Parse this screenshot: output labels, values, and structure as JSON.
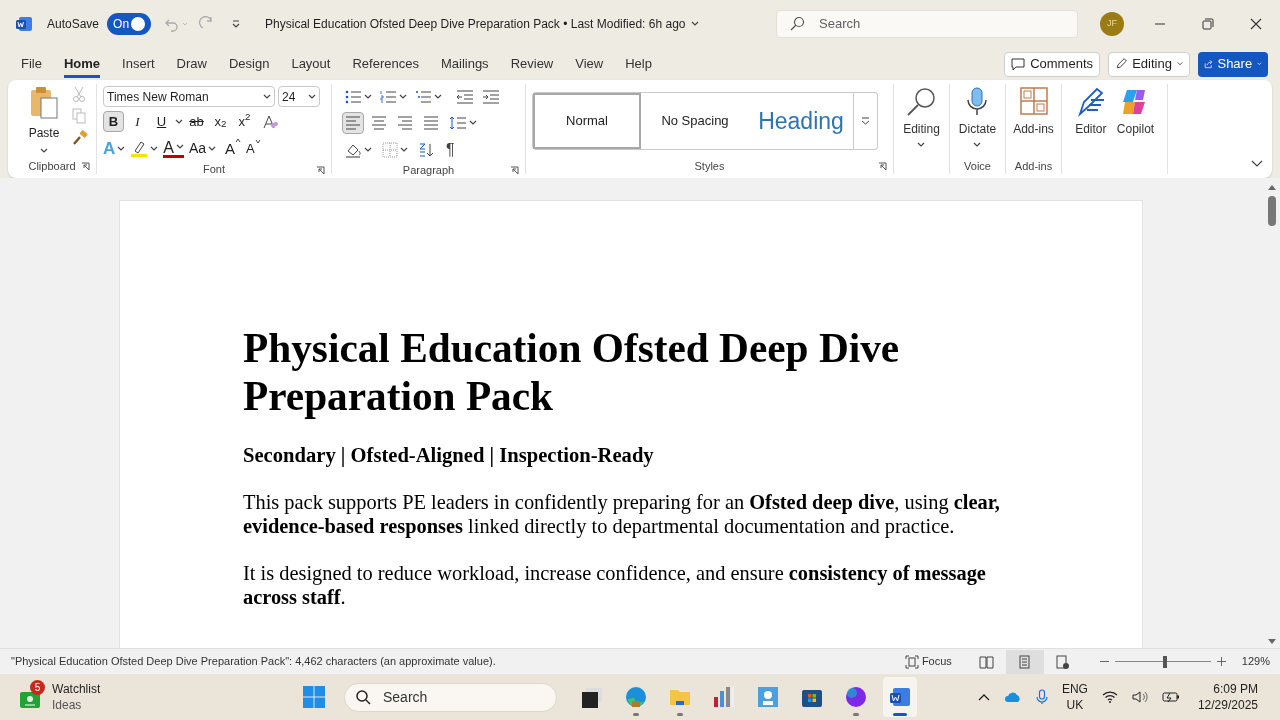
{
  "title_bar": {
    "autosave_label": "AutoSave",
    "autosave": {
      "on": true,
      "label": "On"
    },
    "document_title": "Physical Education Ofsted Deep Dive Preparation Pack • Last Modified: 6h ago",
    "search_placeholder": "Search",
    "avatar_initials": "JF"
  },
  "tabs": [
    {
      "label": "File",
      "selected": false
    },
    {
      "label": "Home",
      "selected": true
    },
    {
      "label": "Insert",
      "selected": false
    },
    {
      "label": "Draw",
      "selected": false
    },
    {
      "label": "Design",
      "selected": false
    },
    {
      "label": "Layout",
      "selected": false
    },
    {
      "label": "References",
      "selected": false
    },
    {
      "label": "Mailings",
      "selected": false
    },
    {
      "label": "Review",
      "selected": false
    },
    {
      "label": "View",
      "selected": false
    },
    {
      "label": "Help",
      "selected": false
    }
  ],
  "header_buttons": [
    {
      "kind": "comments",
      "label": "Comments"
    },
    {
      "kind": "editing",
      "label": "Editing"
    },
    {
      "kind": "share",
      "label": "Share"
    }
  ],
  "ribbon": {
    "clipboard": {
      "paste_label": "Paste",
      "group_label": "Clipboard"
    },
    "font": {
      "name": "Times New Roman",
      "size": "24",
      "group_label": "Font",
      "format_buttons": [
        {
          "label": "B",
          "selected": true
        },
        {
          "label": "I",
          "selected": false
        },
        {
          "label": "U",
          "selected": false
        },
        {
          "label": "ab",
          "selected": false
        },
        {
          "label": "x$_{2}$",
          "selected": false
        },
        {
          "label": "x$^{2}$",
          "selected": false
        }
      ],
      "tools": [
        {
          "kind": "effects",
          "label": "A"
        },
        {
          "kind": "highlight"
        },
        {
          "kind": "color",
          "label": "A"
        },
        {
          "kind": "case",
          "label": "Aa"
        },
        {
          "kind": "grow",
          "label": "A"
        },
        {
          "kind": "shrink",
          "label": "A"
        }
      ]
    },
    "paragraph": {
      "group_label": "Paragraph",
      "pilcrow": "¶",
      "alignment": [
        {
          "kind": "left",
          "selected": true
        },
        {
          "kind": "center",
          "selected": false
        },
        {
          "kind": "right",
          "selected": false
        },
        {
          "kind": "justify",
          "selected": false
        }
      ]
    },
    "styles": {
      "group_label": "Styles",
      "items": [
        {
          "label": "Normal",
          "kind": "body",
          "selected": true
        },
        {
          "label": "No Spacing",
          "kind": "body",
          "selected": false
        },
        {
          "label": "Heading",
          "kind": "heading",
          "selected": false
        }
      ]
    },
    "tool_groups": [
      {
        "buttons": [
          {
            "kind": "editing",
            "label": "Editing",
            "dropdown": true
          }
        ]
      },
      {
        "label": "Voice",
        "buttons": [
          {
            "kind": "dictate",
            "label": "Dictate",
            "dropdown": true
          }
        ]
      },
      {
        "label": "Add-ins",
        "buttons": [
          {
            "kind": "addins",
            "label": "Add-ins",
            "dropdown": false
          }
        ]
      },
      {
        "buttons": [
          {
            "kind": "editor",
            "label": "Editor",
            "dropdown": false
          },
          {
            "kind": "copilot",
            "label": "Copilot",
            "dropdown": false
          }
        ]
      }
    ]
  },
  "document": {
    "paragraphs": [
      {
        "kind": "title",
        "text": "Physical Education Ofsted Deep Dive Preparation Pack"
      },
      {
        "kind": "subtitle",
        "text": "Secondary | Ofsted-Aligned | Inspection-Ready"
      },
      {
        "kind": "body",
        "text": "This pack supports PE leaders in confidently preparing for an **Ofsted deep dive**, using **clear, evidence-based responses** linked directly to departmental documentation and practice."
      },
      {
        "kind": "body",
        "text": "It is designed to reduce workload, increase confidence, and ensure **consistency of message across staff**."
      }
    ]
  },
  "status_bar": {
    "text": "\"Physical Education Ofsted Deep Dive Preparation Pack\": 4,462 characters (an approximate value).",
    "focus_label": "Focus",
    "views": [
      {
        "kind": "read",
        "selected": false
      },
      {
        "kind": "print",
        "selected": true
      },
      {
        "kind": "web",
        "selected": false
      }
    ],
    "zoom": {
      "level": 0.52,
      "label": "129%"
    }
  },
  "taskbar": {
    "widget": {
      "title": "Watchlist",
      "subtitle": "Ideas",
      "badge": "5"
    },
    "search_placeholder": "Search",
    "apps": [
      {
        "kind": "taskview",
        "running": false,
        "selected": false
      },
      {
        "kind": "edge",
        "running": true,
        "selected": false
      },
      {
        "kind": "explorer",
        "running": true,
        "selected": false
      },
      {
        "kind": "charts",
        "running": false,
        "selected": false
      },
      {
        "kind": "contacts",
        "running": false,
        "selected": false
      },
      {
        "kind": "store",
        "running": false,
        "selected": false
      },
      {
        "kind": "canva",
        "running": true,
        "selected": false
      },
      {
        "kind": "word",
        "running": true,
        "selected": true
      }
    ],
    "language": "ENG",
    "region": "UK",
    "time": "6:09 PM",
    "date": "12/29/2025"
  }
}
